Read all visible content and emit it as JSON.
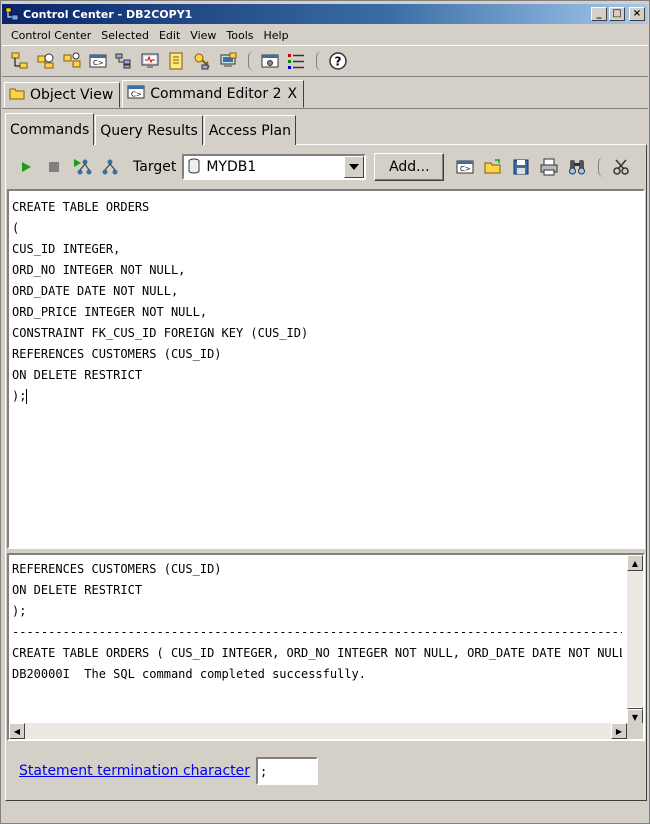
{
  "window": {
    "title": "Control Center - DB2COPY1",
    "buttons": [
      "_",
      "□",
      "×"
    ]
  },
  "menu": [
    "Control Center",
    "Selected",
    "Edit",
    "View",
    "Tools",
    "Help"
  ],
  "toolbar_icons": [
    "object-tree-icon",
    "object-details-icon",
    "replication-icon",
    "command-editor-icon",
    "task-center-icon",
    "health-center-icon",
    "journal-icon",
    "license-center-icon",
    "development-center-icon",
    "tools-settings-icon",
    "show-list-icon",
    "help-icon"
  ],
  "editor_tabs": [
    {
      "label": "Object View"
    },
    {
      "label": "Command Editor 2",
      "close": "X"
    }
  ],
  "sub_tabs": [
    "Commands",
    "Query Results",
    "Access Plan"
  ],
  "command_toolbar": {
    "target_label": "Target",
    "target_value": "MYDB1",
    "add_label": "Add..."
  },
  "editor": {
    "lines": [
      "CREATE TABLE ORDERS",
      "(",
      "CUS_ID INTEGER,",
      "ORD_NO INTEGER NOT NULL,",
      "ORD_DATE DATE NOT NULL,",
      "ORD_PRICE INTEGER NOT NULL,",
      "CONSTRAINT FK_CUS_ID FOREIGN KEY (CUS_ID)",
      "REFERENCES CUSTOMERS (CUS_ID)",
      "ON DELETE RESTRICT",
      ");"
    ]
  },
  "results": {
    "lines": [
      "REFERENCES CUSTOMERS (CUS_ID)",
      "ON DELETE RESTRICT",
      ");",
      "------------------------------------------------------------------------------------------",
      "CREATE TABLE ORDERS ( CUS_ID INTEGER, ORD_NO INTEGER NOT NULL, ORD_DATE DATE NOT NULL",
      "DB20000I  The SQL command completed successfully."
    ]
  },
  "footer": {
    "termination_label": "Statement termination character",
    "termination_value": ";"
  }
}
